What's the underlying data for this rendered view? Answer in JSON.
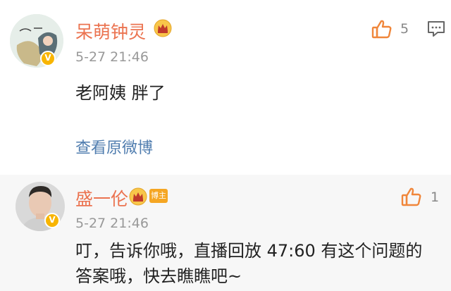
{
  "comments": [
    {
      "username": "呆萌钟灵",
      "time": "5-27 21:46",
      "text": "老阿姨 胖了",
      "like_count": "5",
      "link": "查看原微博"
    },
    {
      "username": "盛一伦",
      "host_badge": "博主",
      "time": "5-27 21:46",
      "text_lines": [
        "叮，告诉你哦，直播回放 47:60 有这个问题的",
        "答案哦，快去瞧瞧吧~"
      ],
      "like_count": "1"
    }
  ],
  "icons": {
    "verified": "V",
    "crown": "crown-icon",
    "like": "thumbs-up-icon",
    "reply": "comment-icon"
  },
  "colors": {
    "username": "#eb7350",
    "link": "#507daf",
    "like_orange": "#f0863a",
    "badge_gold": "#f8b500"
  }
}
